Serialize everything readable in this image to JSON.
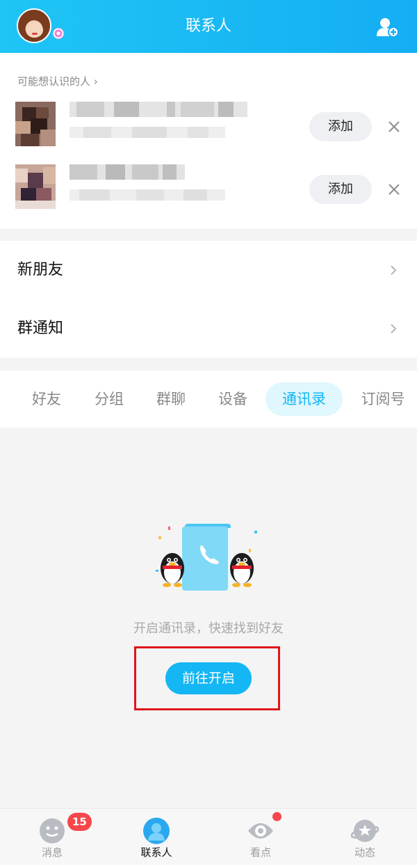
{
  "header": {
    "title": "联系人",
    "avatar_icon": "user-avatar",
    "add_icon": "add-contact-icon",
    "accent_color": "#14aef4"
  },
  "suggestions": {
    "title": "可能想认识的人",
    "add_label": "添加",
    "close_icon": "close-icon",
    "items": [
      {
        "name": "",
        "detail": ""
      },
      {
        "name": "",
        "detail": ""
      }
    ]
  },
  "menu": {
    "items": [
      {
        "label": "新朋友",
        "icon": "chevron-right-icon"
      },
      {
        "label": "群通知",
        "icon": "chevron-right-icon"
      }
    ]
  },
  "tabs": {
    "items": [
      "好友",
      "分组",
      "群聊",
      "设备",
      "通讯录",
      "订阅号"
    ],
    "active": "通讯录"
  },
  "empty_state": {
    "illustration": "contacts-book-penguins-illustration",
    "message": "开启通讯录，快速找到好友",
    "button_label": "前往开启"
  },
  "tabbar": {
    "items": [
      {
        "label": "消息",
        "icon": "message-icon",
        "badge": "15"
      },
      {
        "label": "联系人",
        "icon": "contacts-icon",
        "active": true
      },
      {
        "label": "看点",
        "icon": "eye-icon",
        "dot": true
      },
      {
        "label": "动态",
        "icon": "planet-icon"
      }
    ]
  }
}
